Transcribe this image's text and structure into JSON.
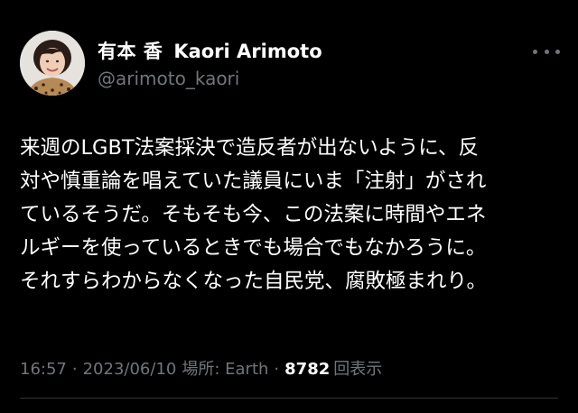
{
  "author": {
    "display_name": "有本 香",
    "latin_name": "Kaori Arimoto",
    "handle": "@arimoto_kaori"
  },
  "tweet": {
    "lines": [
      "来週のLGBT法案採決で造反者が出ないように、反",
      "対や慎重論を唱えていた議員にいま「注射」がされ",
      "ているそうだ。そもそも今、この法案に時間やエネ",
      "ルギーを使っているときでも場合でもなかろうに。",
      "それすらわからなくなった自民党、腐敗極まれり。"
    ]
  },
  "meta": {
    "time": "16:57",
    "separator": "·",
    "date": "2023/06/10",
    "location": "場所: Earth",
    "views_count": "8782",
    "views_label": "回表示"
  },
  "icons": {
    "more": "more-horizontal-icon",
    "avatar": "profile-photo"
  },
  "colors": {
    "background": "#000000",
    "text_primary": "#ffffff",
    "text_secondary": "#71767b",
    "divider": "#2f3336"
  }
}
